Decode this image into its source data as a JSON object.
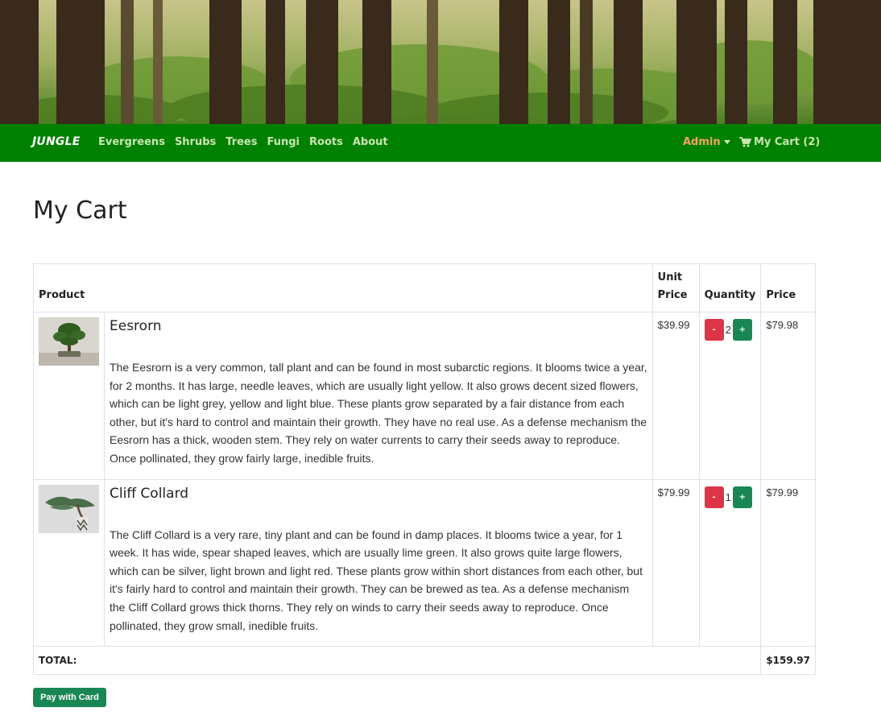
{
  "navbar": {
    "brand": "JUNGLE",
    "links": [
      "Evergreens",
      "Shrubs",
      "Trees",
      "Fungi",
      "Roots",
      "About"
    ],
    "admin_label": "Admin",
    "cart_label": "My Cart (2)"
  },
  "page": {
    "title": "My Cart"
  },
  "table": {
    "headers": {
      "product": "Product",
      "unit_price_line1": "Unit",
      "unit_price_line2": "Price",
      "quantity": "Quantity",
      "price": "Price"
    },
    "rows": [
      {
        "name": "Eesrorn",
        "image_icon": "bonsai-tree-image",
        "description": "The Eesrorn is a very common, tall plant and can be found in most subarctic regions. It blooms twice a year, for 2 months. It has large, needle leaves, which are usually light yellow. It also grows decent sized flowers, which can be light grey, yellow and light blue. These plants grow separated by a fair distance from each other, but it's hard to control and maintain their growth. They have no real use. As a defense mechanism the Eesrorn has a thick, wooden stem. They rely on water currents to carry their seeds away to reproduce. Once pollinated, they grow fairly large, inedible fruits.",
        "unit_price": "$39.99",
        "quantity": "2",
        "price": "$79.98"
      },
      {
        "name": "Cliff Collard",
        "image_icon": "juniper-bonsai-image",
        "description": "The Cliff Collard is a very rare, tiny plant and can be found in damp places. It blooms twice a year, for 1 week. It has wide, spear shaped leaves, which are usually lime green. It also grows quite large flowers, which can be silver, light brown and light red. These plants grow within short distances from each other, but it's fairly hard to control and maintain their growth. They can be brewed as tea. As a defense mechanism the Cliff Collard grows thick thorns. They rely on winds to carry their seeds away to reproduce. Once pollinated, they grow small, inedible fruits.",
        "unit_price": "$79.99",
        "quantity": "1",
        "price": "$79.99"
      }
    ],
    "minus_label": "-",
    "plus_label": "+",
    "total_label": "TOTAL:",
    "total_value": "$159.97"
  },
  "pay_button": "Pay with Card",
  "colors": {
    "navbar": "#008000",
    "nav_link": "#c8e6b0",
    "admin": "#f4a460",
    "minus_button": "#dc3545",
    "plus_button": "#198754",
    "pay_button": "#198754"
  },
  "icons": {
    "cart": "shopping-cart-icon",
    "caret": "caret-down-icon"
  }
}
